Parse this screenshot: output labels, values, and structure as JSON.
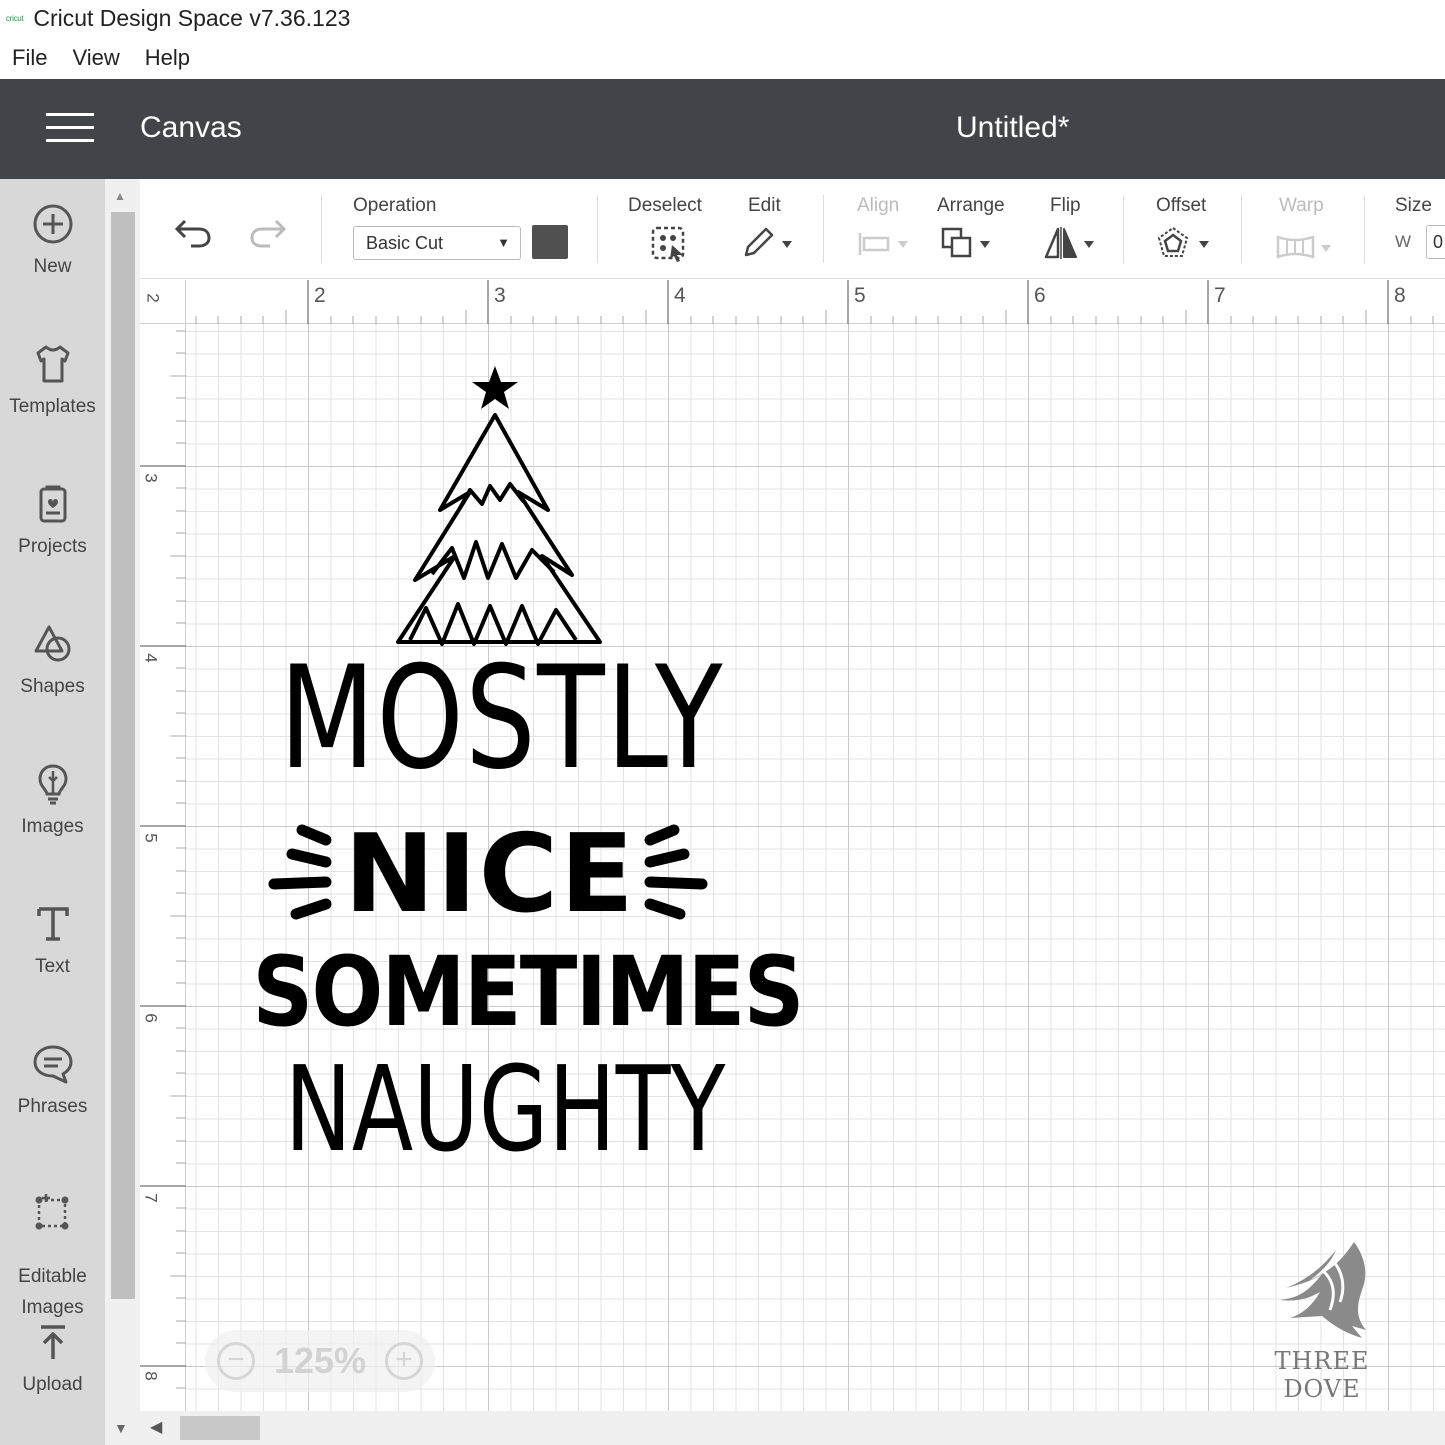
{
  "window": {
    "logo_text": "cricut",
    "title": "Cricut Design Space  v7.36.123"
  },
  "menu": [
    "File",
    "View",
    "Help"
  ],
  "header": {
    "section": "Canvas",
    "document_title": "Untitled*"
  },
  "sidebar": {
    "items": [
      {
        "label": "New",
        "icon": "plus-circle-icon"
      },
      {
        "label": "Templates",
        "icon": "tshirt-icon"
      },
      {
        "label": "Projects",
        "icon": "projects-icon"
      },
      {
        "label": "Shapes",
        "icon": "shapes-icon"
      },
      {
        "label": "Images",
        "icon": "lightbulb-icon"
      },
      {
        "label": "Text",
        "icon": "text-t-icon"
      },
      {
        "label": "Phrases",
        "icon": "speech-bubble-icon"
      },
      {
        "label": "Editable\nImages",
        "icon": "editable-image-icon"
      },
      {
        "label": "Upload",
        "icon": "upload-icon"
      }
    ]
  },
  "toolbar": {
    "undo_icon": "undo-icon",
    "redo_icon": "redo-icon",
    "operation_label": "Operation",
    "operation_value": "Basic Cut",
    "operation_color": "#505050",
    "deselect_label": "Deselect",
    "edit_label": "Edit",
    "align_label": "Align",
    "arrange_label": "Arrange",
    "flip_label": "Flip",
    "offset_label": "Offset",
    "warp_label": "Warp",
    "size_label": "Size",
    "size_w_label": "W",
    "size_w_value": "0"
  },
  "rulers": {
    "top": [
      "2",
      "2",
      "3",
      "4",
      "5",
      "6",
      "7",
      "8"
    ],
    "left": [
      "3",
      "4",
      "5",
      "6",
      "7",
      "8"
    ]
  },
  "design": {
    "lines": [
      "MOSTLY",
      "NICE",
      "SOMETIMES",
      "NAUGHTY"
    ]
  },
  "zoom": {
    "value": "125%",
    "minus": "−",
    "plus": "+"
  },
  "watermark": {
    "text": "THREE DOVE"
  },
  "colors": {
    "header_bg": "#414549",
    "sidebar_bg": "#d8d8d8",
    "brand_green": "#1e9c4e"
  }
}
